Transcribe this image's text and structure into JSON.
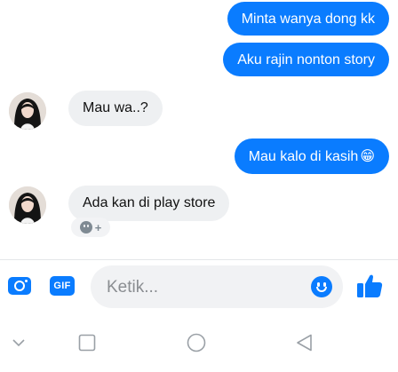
{
  "messages": [
    {
      "side": "out",
      "text": "Minta wanya dong kk"
    },
    {
      "side": "out",
      "text": "Aku rajin nonton story"
    },
    {
      "side": "in",
      "text": "Mau wa..?"
    },
    {
      "side": "out",
      "text": "Mau kalo di kasih",
      "emoji": "😁"
    },
    {
      "side": "in",
      "text": "Ada kan di play store",
      "reaction": "+"
    }
  ],
  "composer": {
    "placeholder": "Ketik...",
    "gif_label": "GIF",
    "icons": [
      "camera-icon",
      "gif-icon",
      "emoji-icon",
      "thumbs-up-icon"
    ]
  },
  "navigation": {
    "icons": [
      "back-chevron-icon",
      "recents-square-icon",
      "home-circle-icon",
      "back-triangle-icon"
    ]
  },
  "colors": {
    "accent": "#0a7cff",
    "incoming_bubble": "#eef0f2",
    "nav_icons": "#9aa0a6"
  }
}
